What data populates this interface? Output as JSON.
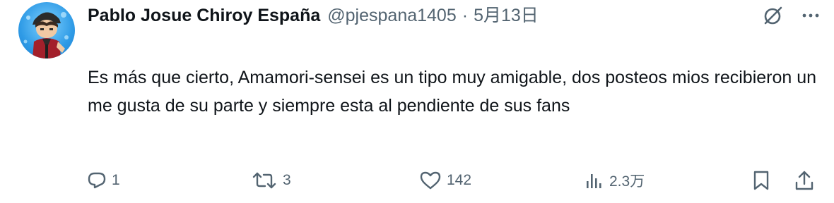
{
  "tweet": {
    "author": {
      "display_name": "Pablo Josue Chiroy España",
      "handle": "@pjespana1405",
      "separator": "·",
      "time": "5月13日"
    },
    "text": "Es más que cierto, Amamori-sensei es un tipo muy amigable, dos posteos mios recibieron un me gusta de su parte y siempre esta al pendiente de sus fans",
    "stats": {
      "replies": "1",
      "retweets": "3",
      "likes": "142",
      "views": "2.3万"
    },
    "icons": {
      "grok": "grok-icon",
      "more": "more-icon",
      "reply": "reply-icon",
      "retweet": "retweet-icon",
      "like": "heart-icon",
      "views": "views-icon",
      "bookmark": "bookmark-icon",
      "share": "share-icon"
    },
    "colors": {
      "text": "#0f1419",
      "secondary": "#536471"
    }
  }
}
